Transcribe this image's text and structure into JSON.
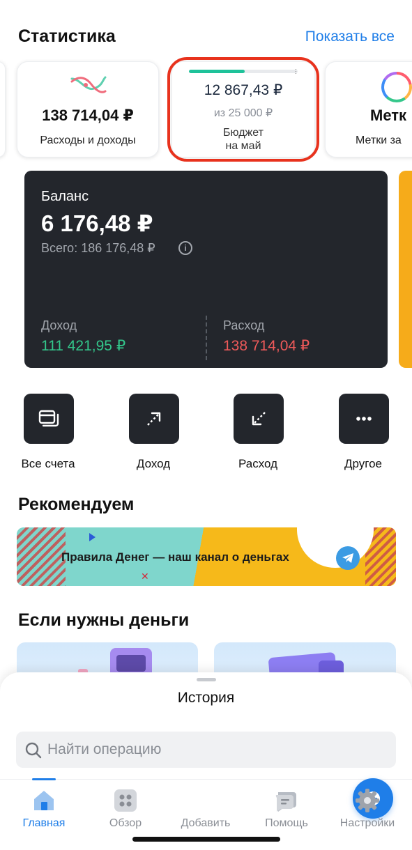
{
  "stats": {
    "title": "Статистика",
    "show_all": "Показать все",
    "expenses_card": {
      "amount": "138 714,04 ₽",
      "label": "Расходы и доходы"
    },
    "budget_card": {
      "amount": "12 867,43 ₽",
      "of": "из 25 000 ₽",
      "label_line1": "Бюджет",
      "label_line2": "на май",
      "progress_fraction": 0.515,
      "highlight_color": "#e8321d"
    },
    "tags_card": {
      "amount": "Метк",
      "label": "Метки за"
    }
  },
  "balance": {
    "label": "Баланс",
    "amount": "6 176,48 ₽",
    "total": "Всего: 186 176,48 ₽",
    "info_glyph": "i",
    "income_label": "Доход",
    "income_value": "111 421,95 ₽",
    "expense_label": "Расход",
    "expense_value": "138 714,04 ₽",
    "colors": {
      "card": "#23262c",
      "income": "#33c78b",
      "expense": "#f05a5a"
    }
  },
  "actions": [
    {
      "label": "Все счета",
      "icon": "wallet-cards-icon"
    },
    {
      "label": "Доход",
      "icon": "arrow-up-right-icon"
    },
    {
      "label": "Расход",
      "icon": "arrow-down-left-icon"
    },
    {
      "label": "Другое",
      "icon": "more-dots-icon"
    }
  ],
  "recommend": {
    "title": "Рекомендуем",
    "banner_text": "Правила Денег — наш канал о деньгах",
    "banner_icon": "telegram-icon"
  },
  "need_money": {
    "title": "Если нужны деньги"
  },
  "history": {
    "title": "История",
    "search_placeholder": "Найти операцию"
  },
  "tabs": [
    {
      "label": "Главная",
      "icon": "home-icon",
      "active": true
    },
    {
      "label": "Обзор",
      "icon": "grid-icon",
      "active": false
    },
    {
      "label": "Добавить",
      "icon": "plus-icon",
      "active": false
    },
    {
      "label": "Помощь",
      "icon": "help-chat-icon",
      "active": false
    },
    {
      "label": "Настройки",
      "icon": "gear-icon",
      "active": false
    }
  ],
  "accent_color": "#1f7ee8"
}
